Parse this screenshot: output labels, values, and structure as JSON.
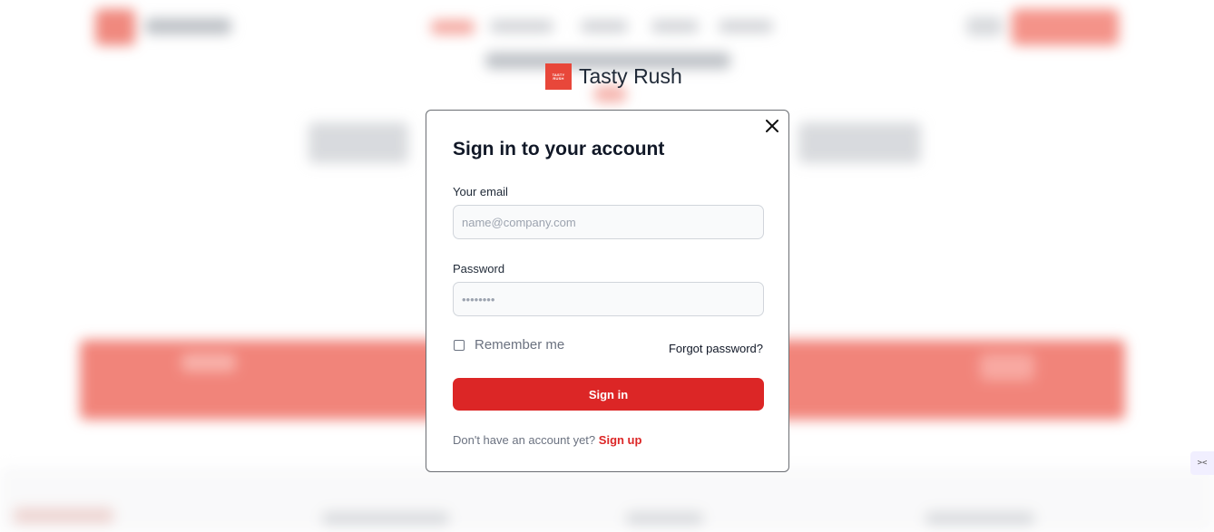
{
  "brand": {
    "logo_line1": "TASTY",
    "logo_line2": "RUSH",
    "name": "Tasty Rush"
  },
  "modal": {
    "title": "Sign in to your account",
    "email": {
      "label": "Your email",
      "placeholder": "name@company.com",
      "value": ""
    },
    "password": {
      "label": "Password",
      "placeholder": "••••••••",
      "value": ""
    },
    "remember_label": "Remember me",
    "remember_checked": false,
    "forgot_label": "Forgot password?",
    "submit_label": "Sign in",
    "signup_prompt": "Don't have an account yet?",
    "signup_label": "Sign up"
  },
  "side_widget": {
    "glyph": "><"
  },
  "colors": {
    "accent": "#dc2626",
    "brand": "#e8473a",
    "title": "#111827",
    "muted": "#6b7280"
  }
}
